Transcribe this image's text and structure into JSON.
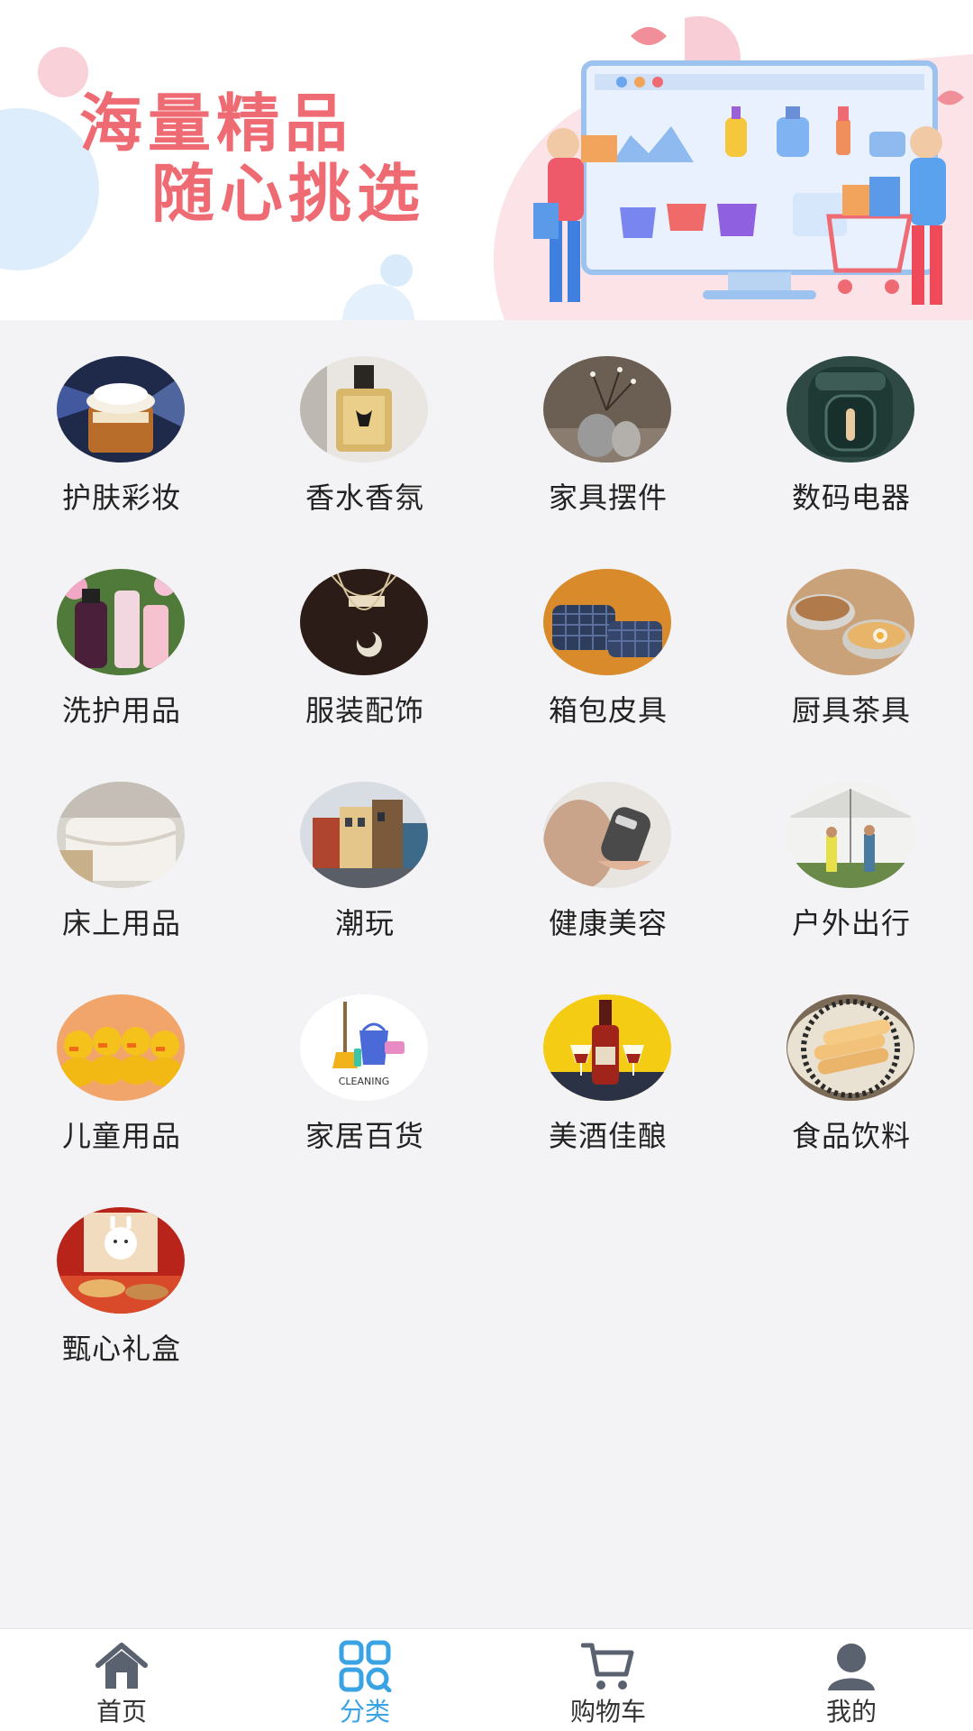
{
  "banner": {
    "line1": "海量精品",
    "line2": "随心挑选"
  },
  "categories": [
    {
      "label": "护肤彩妆",
      "icon": "skincare-photo"
    },
    {
      "label": "香水香氛",
      "icon": "perfume-photo"
    },
    {
      "label": "家具摆件",
      "icon": "furniture-decor-photo"
    },
    {
      "label": "数码电器",
      "icon": "air-fryer-photo"
    },
    {
      "label": "洗护用品",
      "icon": "bath-products-photo"
    },
    {
      "label": "服装配饰",
      "icon": "necklace-photo"
    },
    {
      "label": "箱包皮具",
      "icon": "luggage-photo"
    },
    {
      "label": "厨具茶具",
      "icon": "kitchenware-photo"
    },
    {
      "label": "床上用品",
      "icon": "bedding-photo"
    },
    {
      "label": "潮玩",
      "icon": "toy-building-photo"
    },
    {
      "label": "健康美容",
      "icon": "beauty-device-photo"
    },
    {
      "label": "户外出行",
      "icon": "outdoor-tent-photo"
    },
    {
      "label": "儿童用品",
      "icon": "rubber-ducks-photo"
    },
    {
      "label": "家居百货",
      "icon": "cleaning-supplies-photo"
    },
    {
      "label": "美酒佳酿",
      "icon": "wine-photo"
    },
    {
      "label": "食品饮料",
      "icon": "food-rolls-photo"
    },
    {
      "label": "甄心礼盒",
      "icon": "gift-box-photo"
    }
  ],
  "cleaning_caption": "CLEANING",
  "tabbar": {
    "tabs": [
      {
        "label": "首页",
        "icon": "home-icon",
        "active": false
      },
      {
        "label": "分类",
        "icon": "category-grid-icon",
        "active": true
      },
      {
        "label": "购物车",
        "icon": "cart-icon",
        "active": false
      },
      {
        "label": "我的",
        "icon": "user-icon",
        "active": false
      }
    ]
  },
  "colors": {
    "accent": "#3aa3e3",
    "banner_text": "#ef6b73",
    "page_bg": "#f3f2f4",
    "inactive_icon": "#5a6270"
  }
}
